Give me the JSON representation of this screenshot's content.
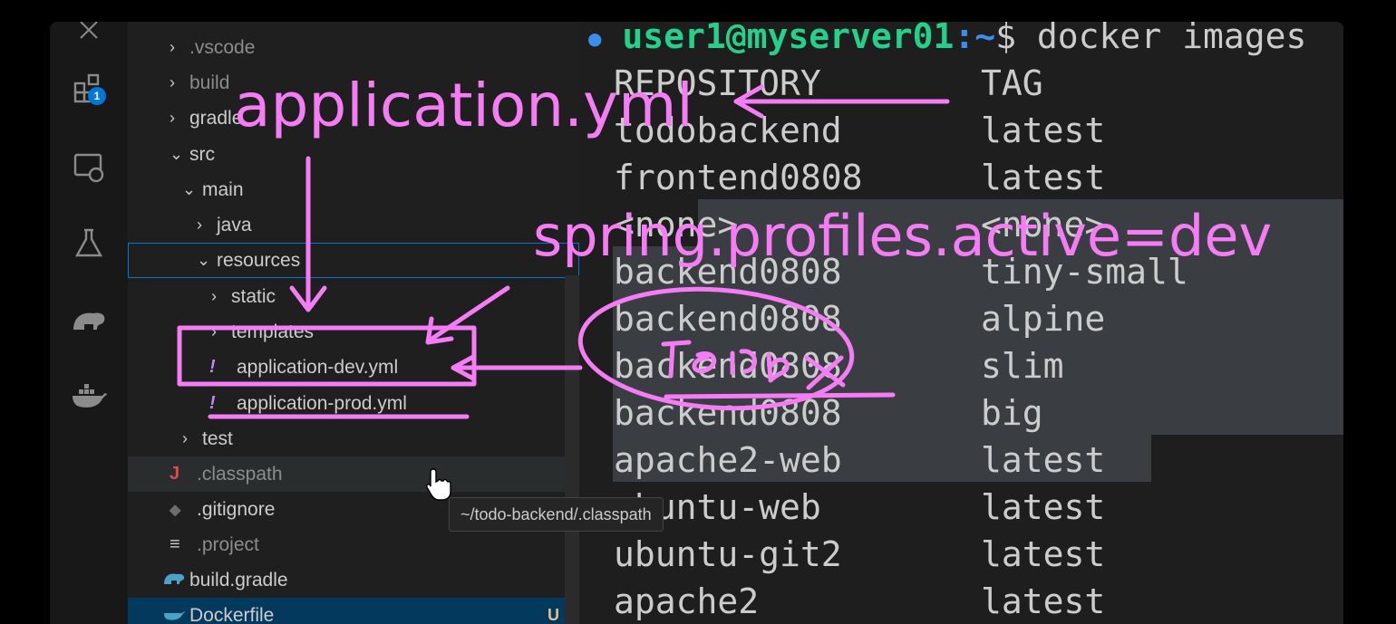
{
  "activity_bar": {
    "items": [
      {
        "icon": "extensions-icon",
        "badge": "1"
      },
      {
        "icon": "remote-explorer-icon"
      },
      {
        "icon": "testing-flask-icon"
      },
      {
        "icon": "gradle-elephant-icon"
      },
      {
        "icon": "docker-whale-icon"
      }
    ]
  },
  "explorer": {
    "items": [
      {
        "label": ".vscode",
        "chevron": "›"
      },
      {
        "label": "build",
        "chevron": "›"
      },
      {
        "label": "gradle",
        "chevron": "›"
      },
      {
        "label": "src",
        "chevron": "⌄"
      },
      {
        "label": "main",
        "chevron": "⌄"
      },
      {
        "label": "java",
        "chevron": "›"
      },
      {
        "label": "resources",
        "chevron": "⌄"
      },
      {
        "label": "static",
        "chevron": "›"
      },
      {
        "label": "templates",
        "chevron": "›"
      },
      {
        "label": "application-dev.yml",
        "icon": "!"
      },
      {
        "label": "application-prod.yml",
        "icon": "!"
      },
      {
        "label": "test",
        "chevron": "›"
      },
      {
        "label": ".classpath",
        "icon": "J"
      },
      {
        "label": ".gitignore",
        "icon": "◆"
      },
      {
        "label": ".project",
        "icon": "≡"
      },
      {
        "label": "build.gradle",
        "icon": "gradle"
      },
      {
        "label": "Dockerfile",
        "icon": "docker",
        "status": "U"
      }
    ]
  },
  "tooltip": "~/todo-backend/.classpath",
  "terminal": {
    "prompt_user": "user1@myserver01",
    "prompt_path": ":~",
    "prompt_symbol": "$",
    "command": " docker images",
    "headers": {
      "repository": "REPOSITORY",
      "tag": "TAG"
    },
    "rows": [
      {
        "repository": "todobackend",
        "tag": "latest"
      },
      {
        "repository": "frontend0808",
        "tag": "latest"
      },
      {
        "repository": "<none>",
        "tag": "<none>"
      },
      {
        "repository": "backend0808",
        "tag": "tiny-small"
      },
      {
        "repository": "backend0808",
        "tag": "alpine"
      },
      {
        "repository": "backend0808",
        "tag": "slim"
      },
      {
        "repository": "backend0808",
        "tag": "big"
      },
      {
        "repository": "apache2-web",
        "tag": "latest"
      },
      {
        "repository": "ubuntu-web",
        "tag": "latest"
      },
      {
        "repository": "ubuntu-git2",
        "tag": "latest"
      },
      {
        "repository": "apache2",
        "tag": "latest"
      }
    ]
  },
  "annotations": {
    "label_1": "application.yml",
    "label_2": "spring.profiles.active=dev",
    "color": "#f57cf5"
  }
}
